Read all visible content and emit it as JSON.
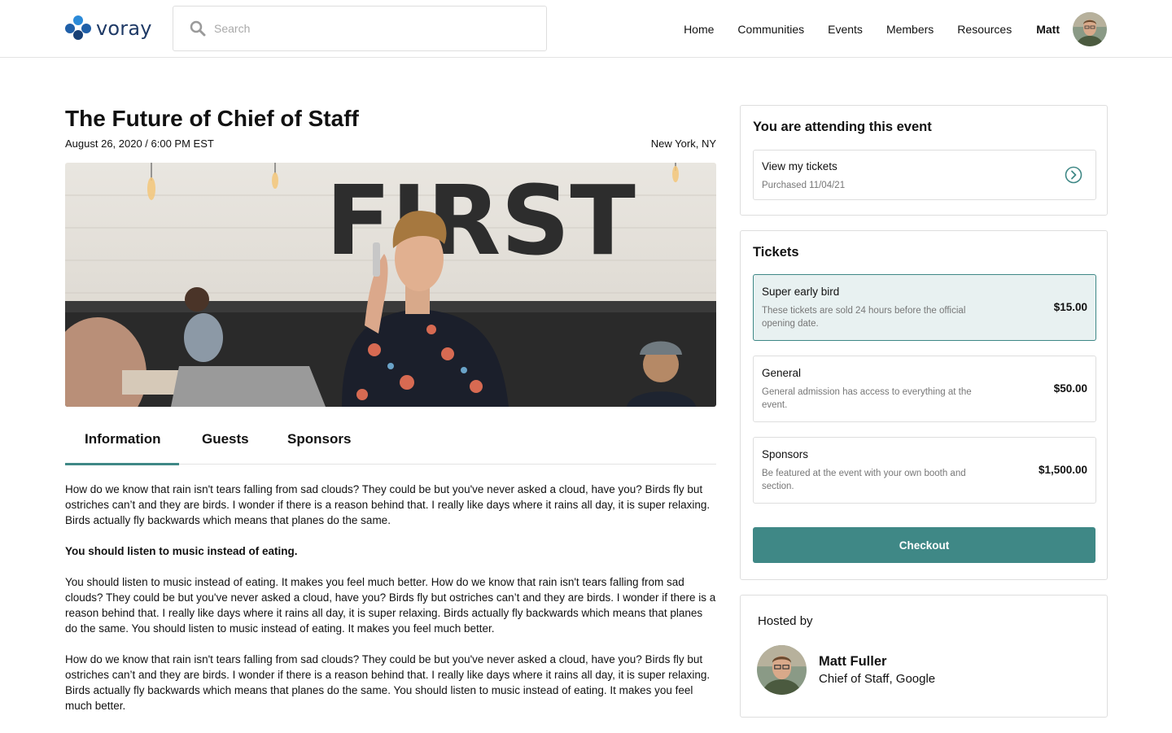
{
  "header": {
    "logo_text": "voray",
    "search_placeholder": "Search",
    "nav": [
      "Home",
      "Communities",
      "Events",
      "Members",
      "Resources"
    ],
    "user_name": "Matt"
  },
  "event": {
    "title": "The Future of Chief of Staff",
    "date": "August 26, 2020 / 6:00 PM EST",
    "location": "New York, NY",
    "hero_sign_text": "FIRST"
  },
  "tabs": [
    "Information",
    "Guests",
    "Sponsors"
  ],
  "content": {
    "p1": "How do we know that rain isn't tears falling from sad clouds? They could be but you've never asked a cloud, have you? Birds fly but ostriches can’t and they are birds. I wonder if there is a reason behind that. I really like days where it rains all day, it is super relaxing. Birds actually fly backwards which means that planes do the same.",
    "heading": "You should listen to music instead of eating.",
    "p2": "You should listen to music instead of eating. It makes you feel much better. How do we know that rain isn't tears falling from sad clouds? They could be but you've never asked a cloud, have you? Birds fly but ostriches can’t and they are birds. I wonder if there is a reason behind that. I really like days where it rains all day, it is super relaxing. Birds actually fly backwards which means that planes do the same. You should listen to music instead of eating. It makes you feel much better.",
    "p3": "How do we know that rain isn't tears falling from sad clouds? They could be but you've never asked a cloud, have you? Birds fly but ostriches can’t and they are birds. I wonder if there is a reason behind that. I really like days where it rains all day, it is super relaxing. Birds actually fly backwards which means that planes do the same. You should listen to music instead of eating. It makes you feel much better."
  },
  "attending": {
    "title": "You are attending this event",
    "view_tickets": "View my tickets",
    "purchased": "Purchased 11/04/21"
  },
  "tickets": {
    "title": "Tickets",
    "items": [
      {
        "name": "Super early bird",
        "desc": "These tickets are sold 24 hours before the official opening date.",
        "price": "$15.00"
      },
      {
        "name": "General",
        "desc": "General admission has access to everything at the event.",
        "price": "$50.00"
      },
      {
        "name": "Sponsors",
        "desc": "Be featured at the event with your own booth and section.",
        "price": "$1,500.00"
      }
    ],
    "checkout_label": "Checkout"
  },
  "host": {
    "label": "Hosted by",
    "name": "Matt Fuller",
    "role": "Chief of Staff, Google"
  },
  "colors": {
    "accent": "#3f8886",
    "selected_bg": "#e8f1f1",
    "logo_blue": "#1f3a66"
  }
}
